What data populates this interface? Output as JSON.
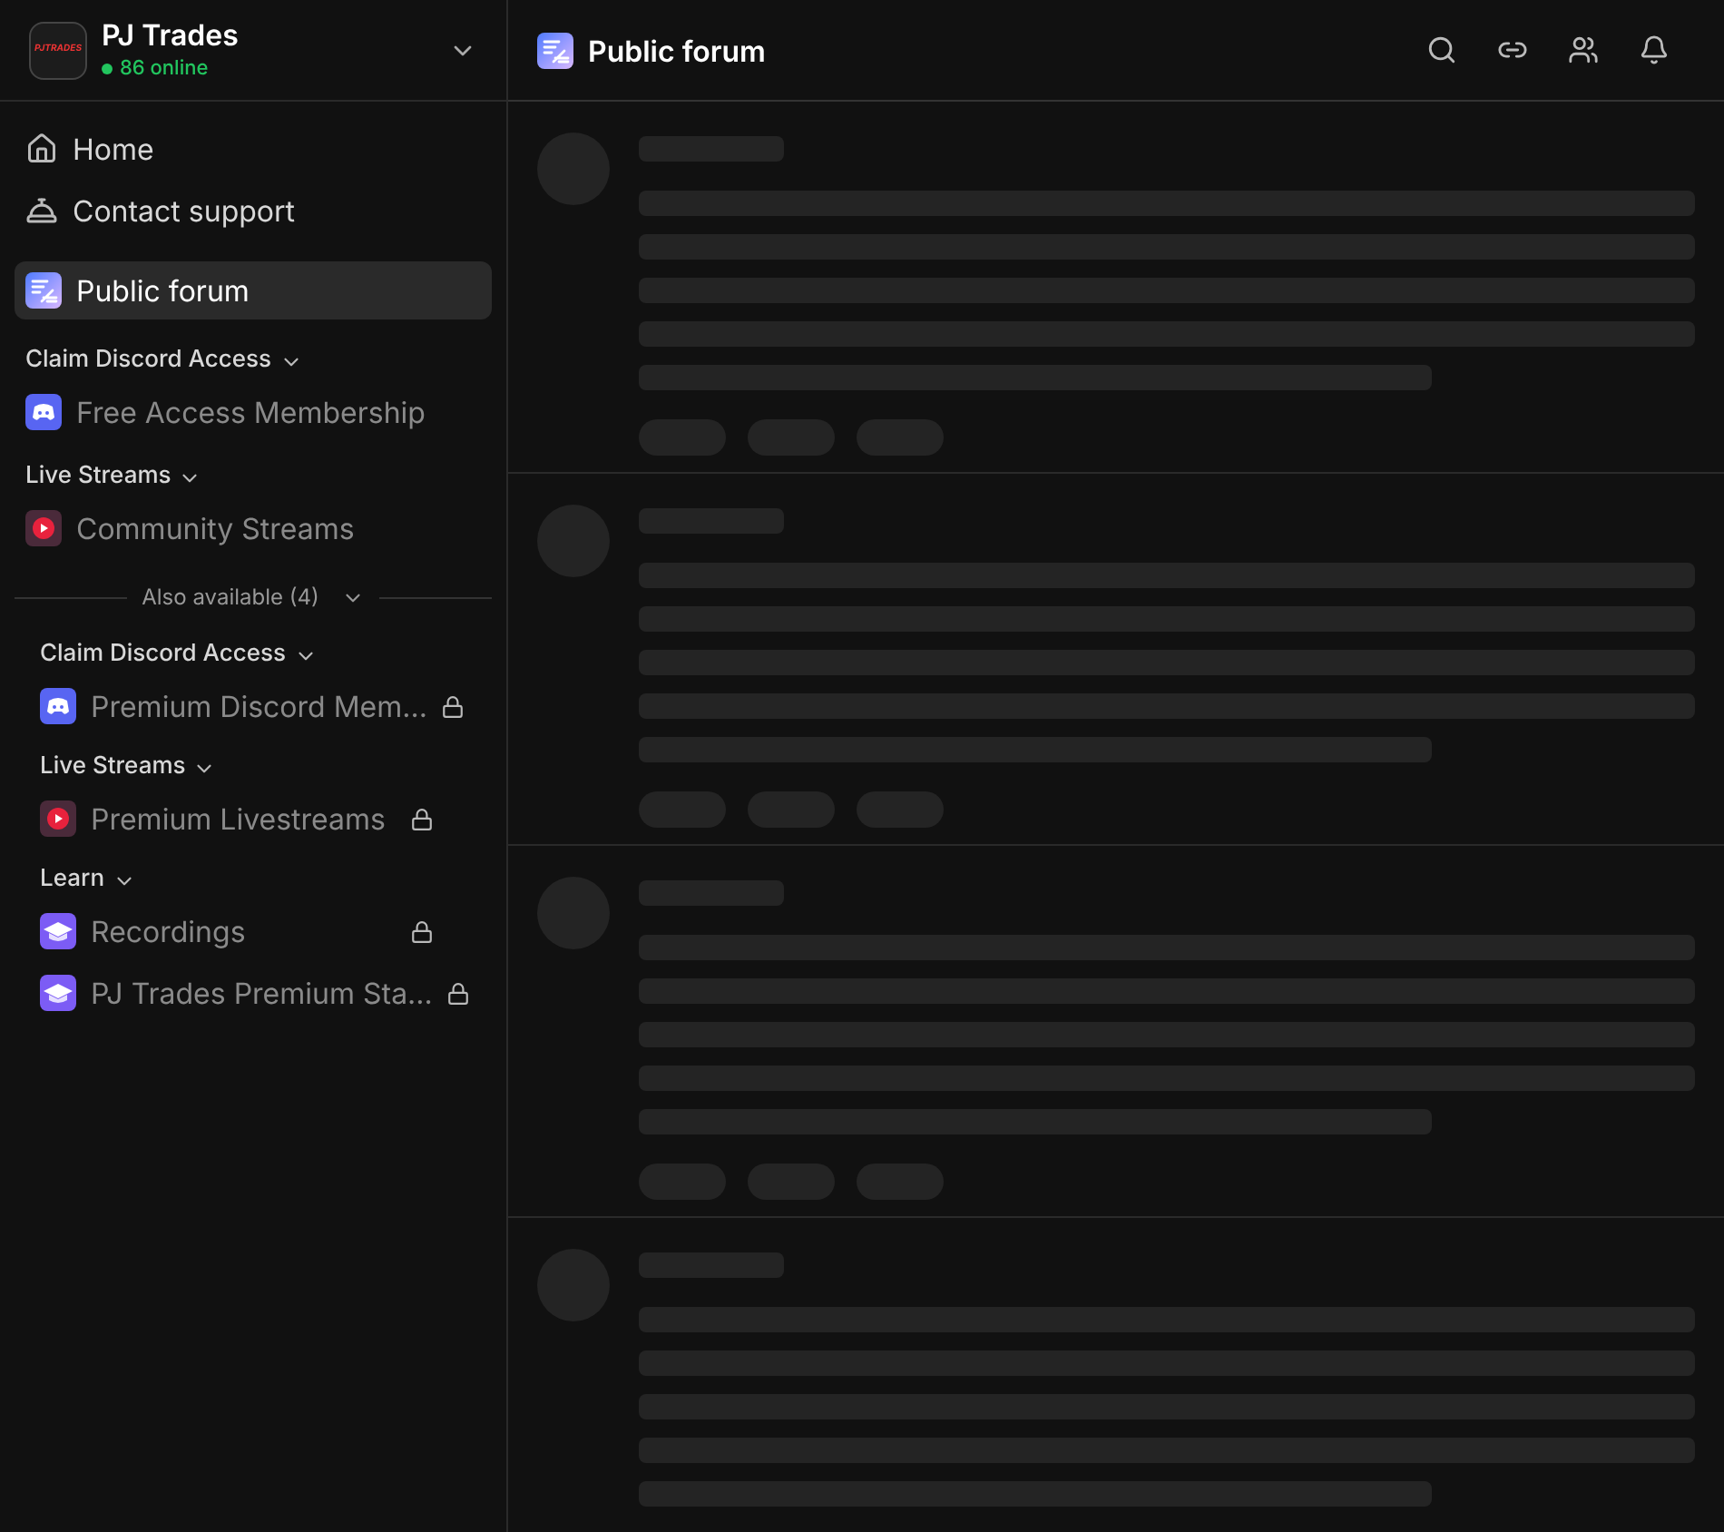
{
  "workspace": {
    "logo_text": "PJTRADES",
    "name": "PJ Trades",
    "online": "86 online"
  },
  "nav": [
    {
      "label": "Home",
      "kind": "home",
      "selected": false
    },
    {
      "label": "Contact support",
      "kind": "support",
      "selected": false
    },
    {
      "label": "Public forum",
      "kind": "forum",
      "selected": true
    }
  ],
  "sections": [
    {
      "title": "Claim Discord Access",
      "items": [
        {
          "label": "Free Access Membership",
          "kind": "discord",
          "locked": false
        }
      ]
    },
    {
      "title": "Live Streams",
      "items": [
        {
          "label": "Community Streams",
          "kind": "stream",
          "locked": false
        }
      ]
    }
  ],
  "also_available": {
    "label": "Also available (4)",
    "sections": [
      {
        "title": "Claim Discord Access",
        "items": [
          {
            "label": "Premium Discord Mem...",
            "kind": "discord",
            "locked": true
          }
        ]
      },
      {
        "title": "Live Streams",
        "items": [
          {
            "label": "Premium Livestreams",
            "kind": "stream",
            "locked": true
          }
        ]
      },
      {
        "title": "Learn",
        "items": [
          {
            "label": "Recordings",
            "kind": "learn",
            "locked": true
          },
          {
            "label": "PJ Trades Premium Sta...",
            "kind": "learn",
            "locked": true
          }
        ]
      }
    ]
  },
  "header": {
    "title": "Public forum"
  },
  "posts": [
    {
      "kind": "skeleton"
    },
    {
      "kind": "skeleton"
    },
    {
      "kind": "skeleton"
    },
    {
      "kind": "skeleton"
    }
  ]
}
